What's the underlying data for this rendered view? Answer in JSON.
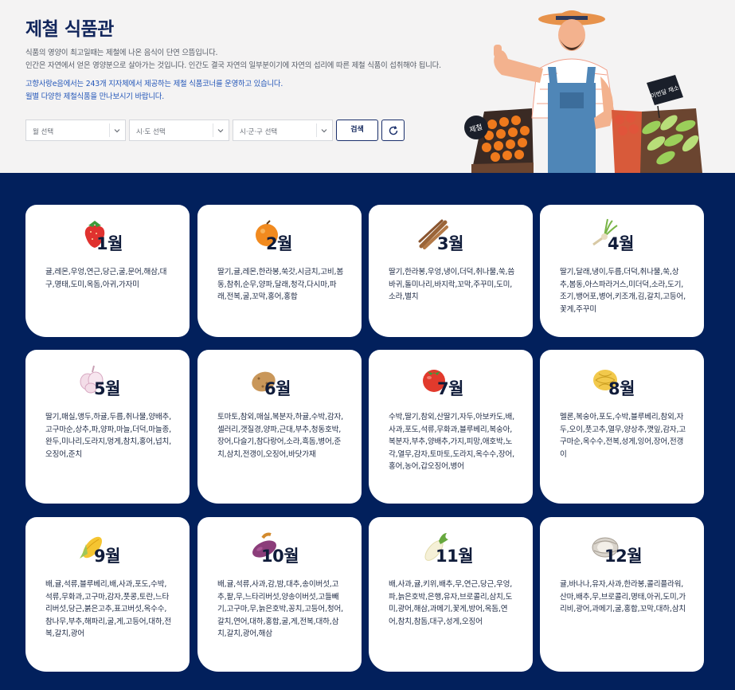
{
  "header": {
    "title": "제철 식품관",
    "desc_lines": [
      "식품의 영양이 최고일때는 제철에 나온 음식이 단연 으뜸입니다.",
      "인간은 자연에서 얻은 영양분으로 살아가는 것입니다. 인간도 결국 자연의 일부분이기에 자연의 섭리에 따른 제철 식품이 섭취해야 됩니다."
    ],
    "notice_lines": [
      "고향사랑e음에서는 243개 지자체에서 제공하는 제철 식품코너를 운영하고 있습니다.",
      "월별 다양한 제철식품을 만나보시기 바랍니다."
    ],
    "filters": {
      "month_placeholder": "월 선택",
      "province_placeholder": "시·도 선택",
      "city_placeholder": "시·군·구 선택",
      "search_label": "검색",
      "reset_icon": "refresh-icon"
    },
    "illustration": {
      "tag_left": "제철",
      "tag_right": "이번달 채소"
    }
  },
  "months": [
    {
      "label": "1월",
      "icon": "strawberry-icon",
      "foods": "귤,레몬,우엉,연근,당근,굴,문어,해삼,대구,명태,도미,옥돔,아귀,가자미"
    },
    {
      "label": "2월",
      "icon": "orange-icon",
      "foods": "딸기,귤,레몬,한라봉,쑥갓,시금치,고비,봄동,참취,순무,양파,달래,청각,다시마,파래,전복,굴,꼬막,홍어,홍합"
    },
    {
      "label": "3월",
      "icon": "burdock-icon",
      "foods": "딸기,한라봉,우엉,냉이,더덕,취나물,쑥,씀바귀,돌미나리,바지락,꼬막,주꾸미,도미,소라,별치"
    },
    {
      "label": "4월",
      "icon": "shepherds-purse-icon",
      "foods": "딸기,달래,냉이,두릅,더덕,취나물,쑥,상추,봄동,아스파라거스,미더덕,소라,도기,조기,뱅어포,병어,키조개,김,갈치,고등어,꽃게,주꾸미"
    },
    {
      "label": "5월",
      "icon": "garlic-icon",
      "foods": "딸기,매실,앵두,하귤,두릅,취나물,양배추,고구마순,상추,파,양파,마늘,더덕,마늘종,완두,미나리,도라지,멍게,참치,홍어,넙치,오징어,준치"
    },
    {
      "label": "6월",
      "icon": "potato-icon",
      "foods": "토마토,참외,매실,복분자,하귤,수박,감자,셀러리,갯질경,양파,근대,부추,청동호박,장어,다슬기,참다랑어,소라,흑돔,병어,준치,삼치,전갱이,오징어,바닷가재"
    },
    {
      "label": "7월",
      "icon": "tomato-icon",
      "foods": "수박,딸기,참외,산딸기,자두,아보카도,배,사과,포도,석류,무화과,블루베리,복숭아,복분자,부추,양배추,가지,피망,애호박,노각,열무,감자,토마토,도라지,옥수수,장어,홍어,농어,갑오징어,병어"
    },
    {
      "label": "8월",
      "icon": "melon-icon",
      "foods": "멜론,복숭아,포도,수박,블루베리,참외,자두,오이,풋고추,열무,양상추,깻잎,감자,고구마순,옥수수,전복,성게,잉어,장어,전갱이"
    },
    {
      "label": "9월",
      "icon": "corn-icon",
      "foods": "배,귤,석류,블루베리,배,사과,포도,수박,석류,무화과,고구마,감자,풋콩,토란,느타리버섯,당근,붉은고추,표고버섯,옥수수,참나무,부추,해파리,굴,게,고등어,대하,전복,갈치,광어"
    },
    {
      "label": "10월",
      "icon": "sweet-potato-icon",
      "foods": "배,귤,석류,사과,감,밤,대추,송이버섯,고추,팥,무,느타리버섯,양송이버섯,고들빼기,고구마,무,늙은호박,꽁치,고등어,청어,갈치,연어,대하,홍합,굴,게,전복,대하,삼치,갈치,광어,해삼"
    },
    {
      "label": "11월",
      "icon": "radish-icon",
      "foods": "배,사과,귤,키위,배추,무,연근,당근,우엉,파,늙은호박,은행,유자,브로콜리,삼치,도미,광어,해삼,과메기,꽃게,방어,옥돔,연어,참치,참돔,대구,성게,오징어"
    },
    {
      "label": "12월",
      "icon": "oyster-icon",
      "foods": "귤,바나나,유자,사과,한라봉,콜리플라워,산마,배추,무,브로콜리,명태,아귀,도미,가리비,광어,과메기,굴,홍합,꼬막,대하,삼치"
    }
  ],
  "colors": {
    "navy": "#02205c",
    "title": "#12265c",
    "notice": "#2356b8"
  }
}
